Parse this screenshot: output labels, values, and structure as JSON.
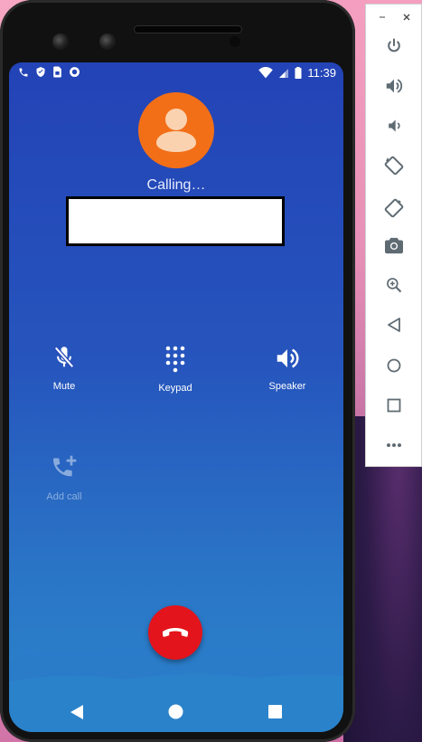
{
  "status_bar": {
    "time": "11:39",
    "left_icons": [
      "phone-icon",
      "shield-icon",
      "sim-card-icon",
      "sync-circle-icon"
    ],
    "right_icons": [
      "wifi-icon",
      "signal-icon",
      "battery-icon"
    ]
  },
  "call": {
    "status": "Calling…"
  },
  "controls": {
    "mute_label": "Mute",
    "keypad_label": "Keypad",
    "speaker_label": "Speaker",
    "add_call_label": "Add call"
  },
  "colors": {
    "avatar": "#f26f17",
    "end_call": "#e3141b",
    "screen_top": "#2343b6",
    "screen_bottom": "#2b85cb"
  },
  "emulator_toolbar": {
    "window_controls": [
      "minimize-icon",
      "close-icon"
    ],
    "buttons": [
      "power-icon",
      "volume-up-icon",
      "volume-down-icon",
      "rotate-left-icon",
      "rotate-right-icon",
      "camera-icon",
      "zoom-icon",
      "back-icon",
      "home-icon",
      "overview-icon",
      "more-icon"
    ]
  }
}
